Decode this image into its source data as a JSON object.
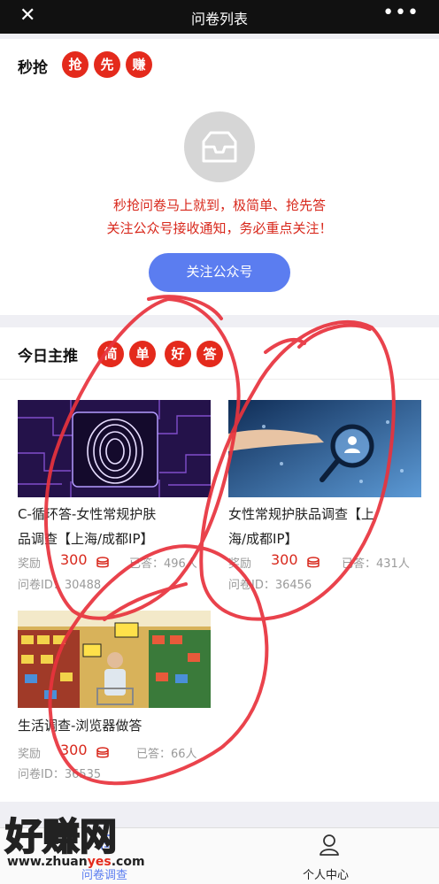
{
  "nav": {
    "close_icon": "close-icon",
    "title": "问卷列表",
    "more_label": "•••"
  },
  "flash": {
    "title": "秒抢",
    "badges": [
      "抢",
      "先",
      "赚"
    ],
    "empty_icon": "inbox-tray-icon",
    "notice_line1": "秒抢问卷马上就到，极简单、抢先答",
    "notice_line2": "关注公众号接收通知，务必重点关注！",
    "follow_button": "关注公众号"
  },
  "featured": {
    "title": "今日主推",
    "badges": [
      "简",
      "单",
      "好",
      "答"
    ],
    "surveys": [
      {
        "title_line1": "C-循环答-女性常规护肤",
        "title_line2": "品调查【上海/成都IP】",
        "reward_label": "奖励",
        "reward": "300",
        "answered": "已答：496人",
        "id_label": "问卷ID：30488",
        "image": "fingerprint-circuit-image"
      },
      {
        "title_line1": "女性常规护肤品调查【上",
        "title_line2": "海/成都IP】",
        "reward_label": "奖励",
        "reward": "300",
        "answered": "已答：431人",
        "id_label": "问卷ID：36456",
        "image": "magnifier-people-image"
      },
      {
        "title_line1": "生活调查-浏览器做答",
        "reward_label": "奖励",
        "reward": "300",
        "answered": "已答：66人",
        "id_label": "问卷ID：36535",
        "image": "supermarket-image"
      }
    ]
  },
  "tabbar": {
    "tab1": "问卷调查",
    "tab2": "个人中心"
  },
  "watermark": {
    "text": "好赚网",
    "url_prefix": "www.zhuan",
    "url_accent": "yes",
    "url_suffix": ".com"
  },
  "colors": {
    "accent_red": "#e42a1c",
    "button_blue": "#5b7df0",
    "annotation_red": "#e8333d",
    "topbar": "#111111"
  }
}
